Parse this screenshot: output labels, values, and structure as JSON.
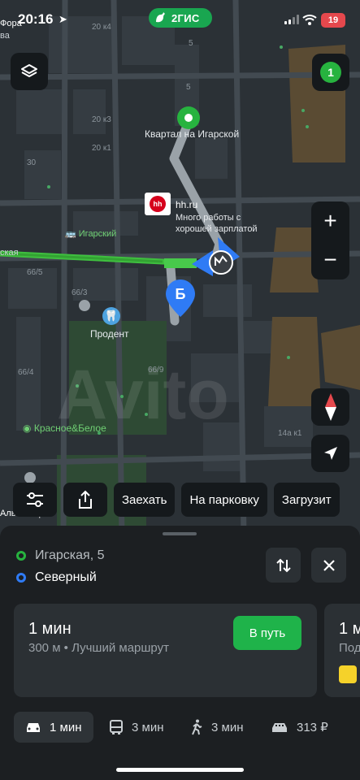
{
  "status_bar": {
    "time": "20:16",
    "battery": "19"
  },
  "brand": {
    "name": "2ГИС"
  },
  "map": {
    "counter_badge": "1",
    "labels": {
      "fora": "Фора",
      "va": "ва",
      "h20k4": "20 к4",
      "h5a": "5",
      "h5b": "5",
      "h20k3": "20 к3",
      "h20k1": "20 к1",
      "h30": "30",
      "igarsky": "Игарский",
      "skaya": "ская",
      "h66_5": "66/5",
      "h66_3": "66/3",
      "h66_4": "66/4",
      "h66_9": "66/9",
      "h14a_k1": "14а к1",
      "krasnoe": "Красное&Белое",
      "alma": "Альм..тоф"
    },
    "start_marker_label": "Квартал на Игарской",
    "billboard": {
      "logo": "hh",
      "title": "hh.ru",
      "line1": "Много работы с",
      "line2": "хорошей зарплатой"
    },
    "end_marker_letter": "Б",
    "poi_prodent": "Продент",
    "watermark": "Avito"
  },
  "chips": [
    "Заехать",
    "На парковку",
    "Загрузит"
  ],
  "route": {
    "from": "Игарская, 5",
    "to": "Северный",
    "colors": {
      "from": "#27b33f",
      "to": "#2f7bf5"
    }
  },
  "cards": [
    {
      "duration": "1 мин",
      "subtitle": "300 м • Лучший маршрут",
      "action": "В путь"
    },
    {
      "duration": "1 м",
      "subtitle": "Под"
    }
  ],
  "modes": [
    {
      "icon": "car-icon",
      "label": "1 мин",
      "active": true
    },
    {
      "icon": "bus-icon",
      "label": "3 мин"
    },
    {
      "icon": "walk-icon",
      "label": "3 мин"
    },
    {
      "icon": "taxi-icon",
      "label": "313 ₽"
    }
  ]
}
